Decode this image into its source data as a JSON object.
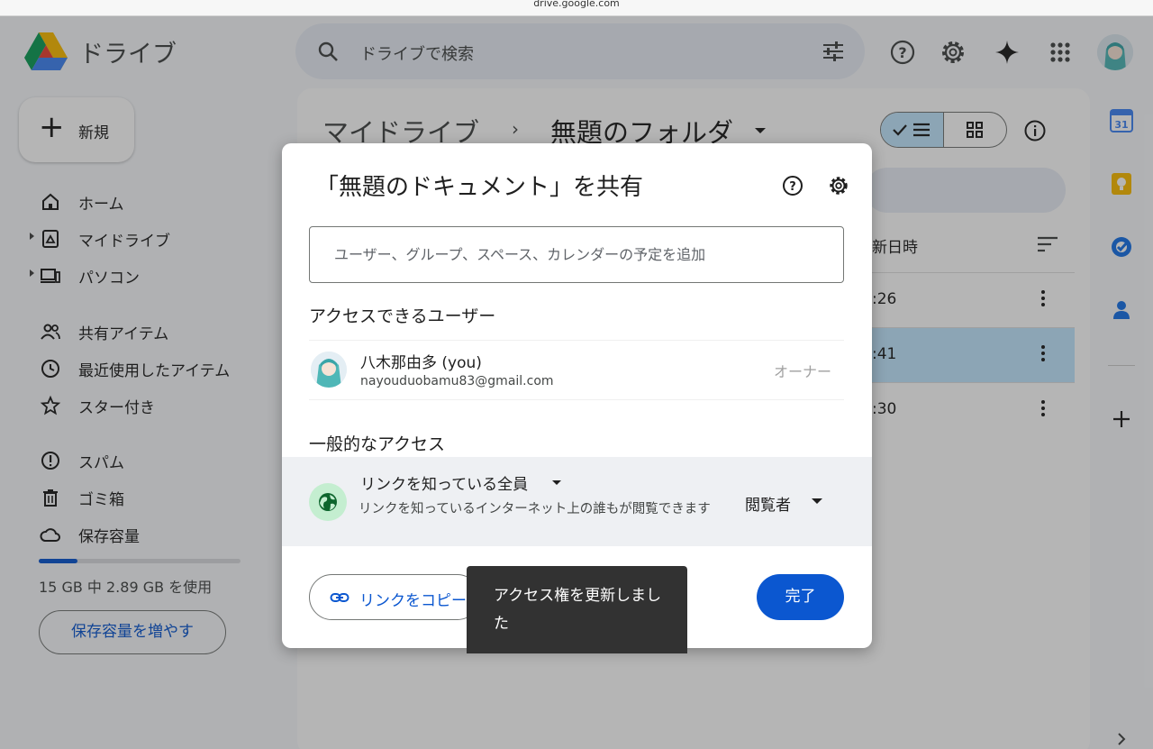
{
  "browser": {
    "url": "drive.google.com"
  },
  "app": {
    "name": "ドライブ",
    "search_placeholder": "ドライブで検索"
  },
  "sidebar": {
    "new_label": "新規",
    "items": [
      {
        "label": "ホーム",
        "icon": "home-icon"
      },
      {
        "label": "マイドライブ",
        "icon": "my-drive-icon"
      },
      {
        "label": "パソコン",
        "icon": "computer-icon"
      },
      {
        "label": "共有アイテム",
        "icon": "people-icon"
      },
      {
        "label": "最近使用したアイテム",
        "icon": "clock-icon"
      },
      {
        "label": "スター付き",
        "icon": "star-icon"
      },
      {
        "label": "スパム",
        "icon": "spam-icon"
      },
      {
        "label": "ゴミ箱",
        "icon": "trash-icon"
      },
      {
        "label": "保存容量",
        "icon": "cloud-icon"
      }
    ],
    "storage_text": "15 GB 中 2.89 GB を使用",
    "storage_used_fraction": 0.19,
    "more_storage_label": "保存容量を増やす"
  },
  "main": {
    "breadcrumb_root": "マイドライブ",
    "breadcrumb_sep": "›",
    "breadcrumb_current": "無題のフォルダ",
    "column_header": "新日時",
    "rows": [
      {
        "time": ":26"
      },
      {
        "time": ":41"
      },
      {
        "time": ":30"
      }
    ]
  },
  "dialog": {
    "title": "「無題のドキュメント」を共有",
    "input_placeholder": "ユーザー、グループ、スペース、カレンダーの予定を追加",
    "people_heading": "アクセスできるユーザー",
    "person": {
      "name": "八木那由多 (you)",
      "email": "nayouduobamu83@gmail.com",
      "role": "オーナー"
    },
    "general_heading": "一般的なアクセス",
    "general": {
      "title": "リンクを知っている全員",
      "description": "リンクを知っているインターネット上の誰もが閲覧できます",
      "role": "閲覧者"
    },
    "copy_link_label": "リンクをコピー",
    "done_label": "完了"
  },
  "toast": {
    "message": "アクセス権を更新しました"
  },
  "colors": {
    "accent": "#0b57d0",
    "selected_row": "#c2e7ff",
    "globe_bg": "#c4eed0",
    "toast_bg": "#323232"
  }
}
